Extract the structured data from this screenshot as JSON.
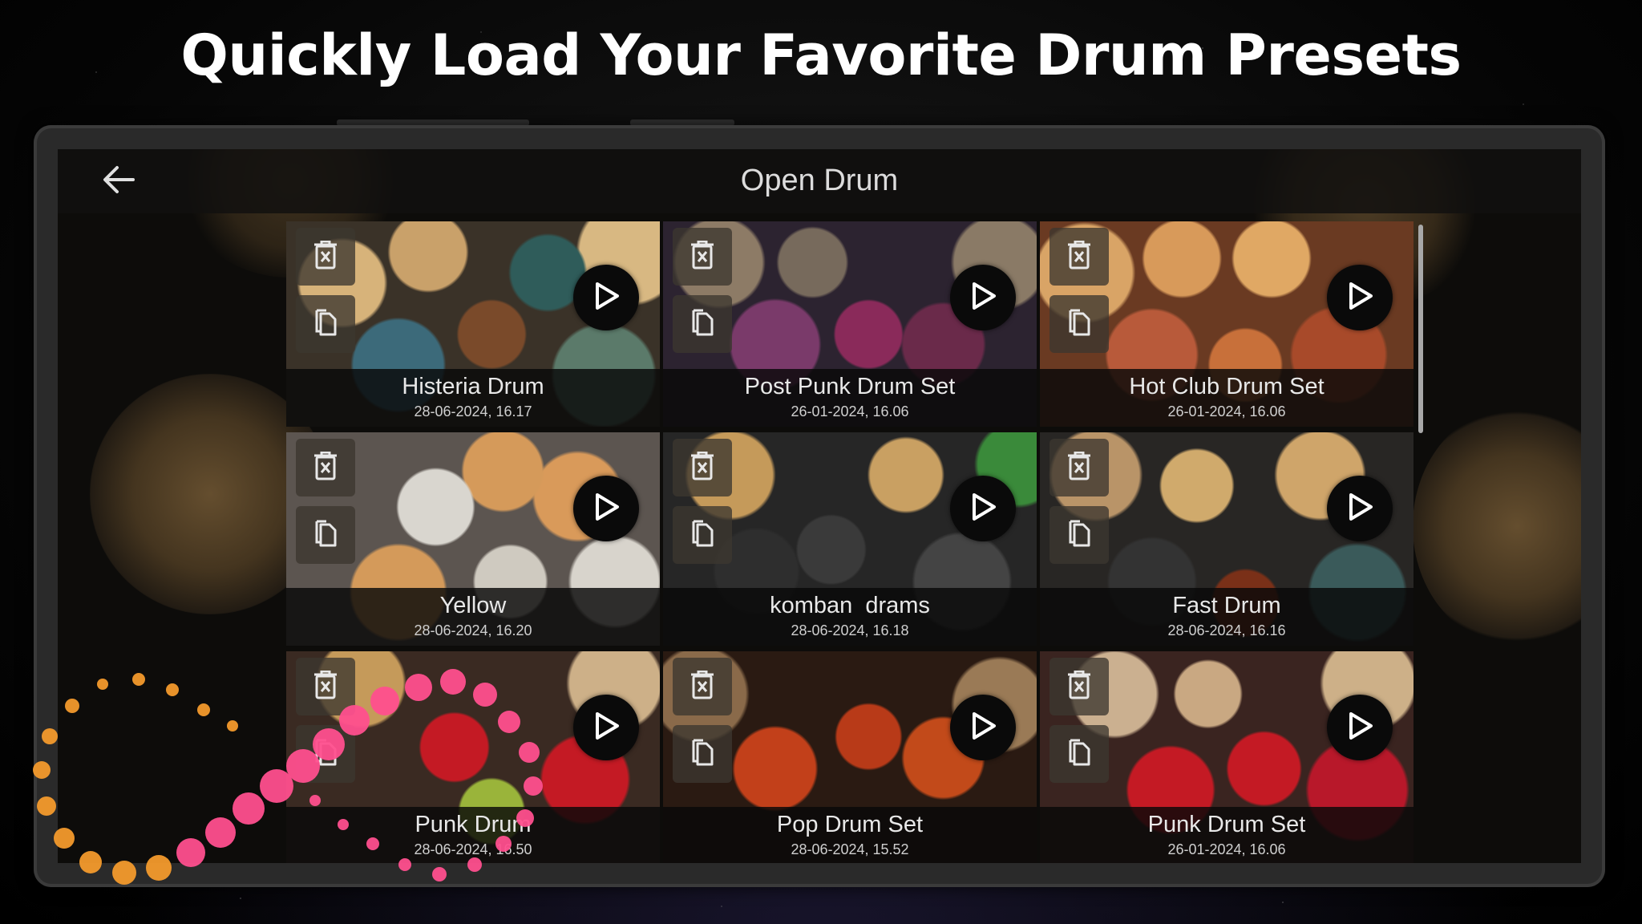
{
  "headline": "Quickly Load Your Favorite Drum Presets",
  "app": {
    "title": "Open Drum",
    "back_icon": "arrow-left-icon"
  },
  "presets": [
    {
      "name": "Histeria Drum",
      "date": "28-06-2024, 16.17"
    },
    {
      "name": "Post Punk Drum Set",
      "date": "26-01-2024, 16.06"
    },
    {
      "name": "Hot Club Drum Set",
      "date": "26-01-2024, 16.06"
    },
    {
      "name": "Yellow",
      "date": "28-06-2024, 16.20"
    },
    {
      "name": "komban  drams",
      "date": "28-06-2024, 16.18"
    },
    {
      "name": "Fast Drum",
      "date": "28-06-2024, 16.16"
    },
    {
      "name": "Punk Drum",
      "date": "28-06-2024, 16.50"
    },
    {
      "name": "Pop Drum Set",
      "date": "28-06-2024, 15.52"
    },
    {
      "name": "Punk Drum Set",
      "date": "26-01-2024, 16.06"
    }
  ],
  "icons": {
    "delete": "delete-icon",
    "copy": "copy-icon",
    "play": "play-icon"
  },
  "colors": {
    "cymbal": "#c89a5a",
    "accent_pink": "#ff4f8e",
    "accent_orange": "#f39a2c"
  }
}
